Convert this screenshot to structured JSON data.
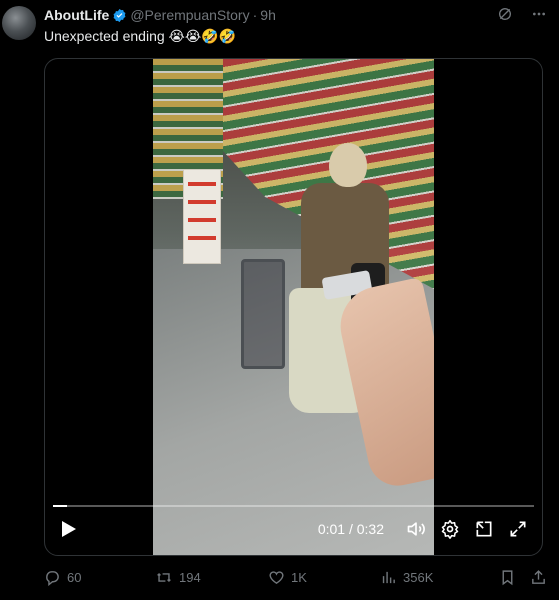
{
  "tweet": {
    "display_name": "AboutLife",
    "handle": "@PerempuanStory",
    "separator": "·",
    "time": "9h",
    "text": "Unexpected ending 😭😭🤣🤣"
  },
  "video": {
    "time_current": "0:01",
    "time_separator": "/",
    "time_total": "0:32",
    "progress_fraction": 0.03
  },
  "actions": {
    "replies": "60",
    "reposts": "194",
    "likes": "1K",
    "views": "356K"
  },
  "colors": {
    "background": "#000000",
    "text_primary": "#e7e9ea",
    "text_secondary": "#71767b",
    "verified": "#1d9bf0",
    "border": "#2f3336"
  },
  "icons": {
    "verified": "verified-badge-icon",
    "grok": "grok-icon",
    "more": "more-icon",
    "play": "play-icon",
    "volume": "volume-icon",
    "settings": "settings-icon",
    "pip": "picture-in-picture-icon",
    "fullscreen": "fullscreen-icon",
    "reply": "reply-icon",
    "repost": "repost-icon",
    "like": "like-icon",
    "views": "views-icon",
    "bookmark": "bookmark-icon",
    "share": "share-icon"
  }
}
